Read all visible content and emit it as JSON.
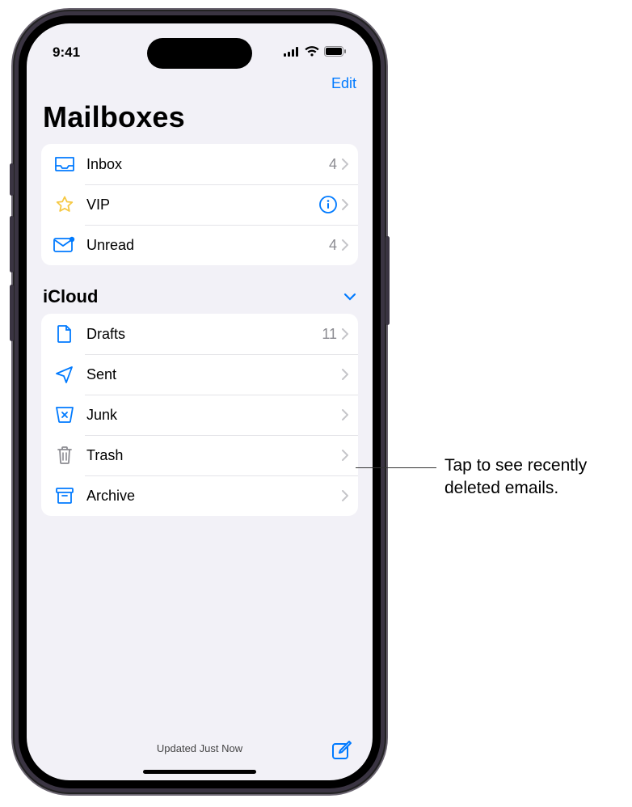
{
  "status": {
    "time": "9:41"
  },
  "nav": {
    "edit": "Edit"
  },
  "title": "Mailboxes",
  "smart": {
    "items": [
      {
        "label": "Inbox",
        "count": "4",
        "icon": "inbox"
      },
      {
        "label": "VIP",
        "info": true,
        "icon": "star"
      },
      {
        "label": "Unread",
        "count": "4",
        "icon": "unread"
      }
    ]
  },
  "section": {
    "title": "iCloud"
  },
  "icloud": {
    "items": [
      {
        "label": "Drafts",
        "count": "11",
        "icon": "drafts"
      },
      {
        "label": "Sent",
        "icon": "sent"
      },
      {
        "label": "Junk",
        "icon": "junk"
      },
      {
        "label": "Trash",
        "icon": "trash"
      },
      {
        "label": "Archive",
        "icon": "archive"
      }
    ]
  },
  "bottom": {
    "status": "Updated Just Now"
  },
  "callout": {
    "text": "Tap to see recently deleted emails."
  }
}
